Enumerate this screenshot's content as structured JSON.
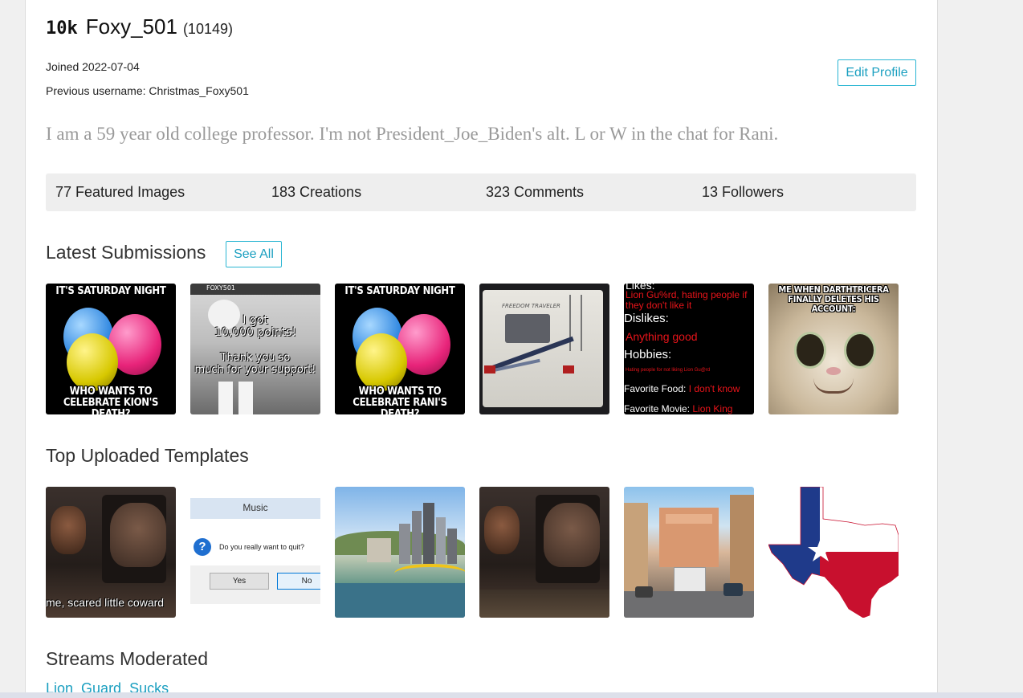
{
  "profile": {
    "score_badge": "10k",
    "username": "Foxy_501",
    "points": "(10149)",
    "joined": "Joined 2022-07-04",
    "previous_username": "Previous username: Christmas_Foxy501",
    "edit_profile_label": "Edit Profile",
    "bio": "I am a 59 year old college professor. I'm not President_Joe_Biden's alt. L or W in the chat for Rani."
  },
  "stats": {
    "featured": "77 Featured Images",
    "creations": "183 Creations",
    "comments": "323 Comments",
    "followers": "13 Followers"
  },
  "latest": {
    "title": "Latest Submissions",
    "see_all_label": "See All",
    "items": [
      {
        "top": "IT'S SATURDAY NIGHT",
        "bottom": "WHO WANTS TO CELEBRATE KION'S DEATH?"
      },
      {
        "label_small": "FOXY501",
        "line1": "I got",
        "line2": "10,000 points!",
        "line3": "Thank you so",
        "line4": "much for your support!"
      },
      {
        "top": "IT'S SATURDAY NIGHT",
        "bottom": "WHO WANTS TO CELEBRATE RANI'S DEATH?"
      },
      {
        "brand": "FREEDOM TRAVELER"
      },
      {
        "l1": "Likes:",
        "l2": "Lion Gu%rd, hating people if they don't like it",
        "l3": "Dislikes:",
        "l4": "Anything good",
        "l5": "Hobbies:",
        "l6": "Hating people for not liking Lion Gu@rd",
        "l7a": "Favorite Food:",
        "l7b": "I don't know",
        "l8a": "Favorite Movie:",
        "l8b": "Lion King"
      },
      {
        "top": "ME WHEN DARTHTRICERA FINALLY DELETES HIS ACCOUNT:"
      }
    ]
  },
  "templates": {
    "title": "Top Uploaded Templates",
    "items": [
      {
        "caption": "me, scared little coward"
      },
      {
        "window_title": "Music",
        "question": "Do you really want to quit?",
        "yes": "Yes",
        "no": "No"
      },
      {},
      {},
      {},
      {}
    ]
  },
  "streams": {
    "title": "Streams Moderated",
    "link": "Lion_Guard_Sucks"
  },
  "colors": {
    "accent": "#1a9fc0",
    "bio": "#9a9a9a",
    "stats_bg": "#eeeeee"
  }
}
